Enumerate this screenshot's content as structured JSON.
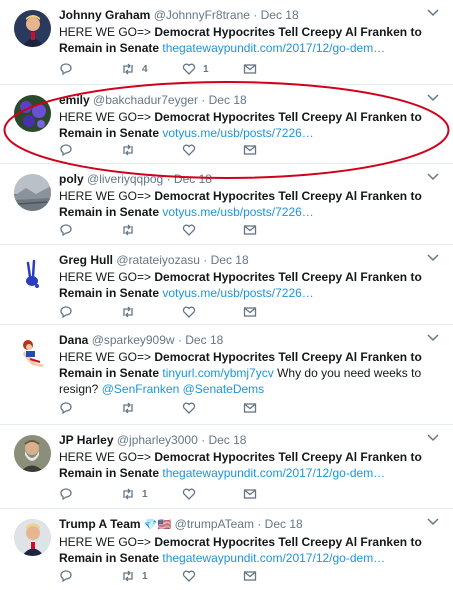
{
  "tweets": [
    {
      "name": "Johnny Graham",
      "handle": "@JohnnyFr8trane",
      "time": "Dec 18",
      "prefix": "HERE WE GO=> ",
      "bold": "Democrat Hypocrites Tell Creepy Al Franken to Remain in Senate",
      "link": "thegatewaypundit.com/2017/12/go-dem…",
      "extra": "",
      "mentions": "",
      "retweets": "4",
      "likes": "1",
      "avatar": "portrait-dark"
    },
    {
      "name": "emily",
      "handle": "@bakchadur7eyger",
      "time": "Dec 18",
      "prefix": "HERE WE GO=> ",
      "bold": "Democrat Hypocrites Tell Creepy Al Franken to Remain in Senate",
      "link": "votyus.me/usb/posts/7226…",
      "extra": "",
      "mentions": "",
      "retweets": "",
      "likes": "",
      "avatar": "purple-flowers"
    },
    {
      "name": "poly",
      "handle": "@liveriyqqpog",
      "time": "Dec 18",
      "prefix": "HERE WE GO=> ",
      "bold": "Democrat Hypocrites Tell Creepy Al Franken to Remain in Senate",
      "link": "votyus.me/usb/posts/7226…",
      "extra": "",
      "mentions": "",
      "retweets": "",
      "likes": "",
      "avatar": "grey-landscape"
    },
    {
      "name": "Greg Hull",
      "handle": "@ratateiyozasu",
      "time": "Dec 18",
      "prefix": "HERE WE GO=> ",
      "bold": "Democrat Hypocrites Tell Creepy Al Franken to Remain in Senate",
      "link": "votyus.me/usb/posts/7226…",
      "extra": "",
      "mentions": "",
      "retweets": "",
      "likes": "",
      "avatar": "blue-rabbit"
    },
    {
      "name": "Dana",
      "handle": "@sparkey909w",
      "time": "Dec 18",
      "prefix": "HERE WE GO=> ",
      "bold": "Democrat Hypocrites Tell Creepy Al Franken to Remain in Senate",
      "link": "tinyurl.com/ybmj7ycv",
      "extra": " Why do you need weeks to resign? ",
      "mention1": "@SenFranken",
      "mention2": "@SenateDems",
      "retweets": "",
      "likes": "",
      "avatar": "pinup"
    },
    {
      "name": "JP Harley",
      "handle": "@jpharley3000",
      "time": "Dec 18",
      "prefix": "HERE WE GO=> ",
      "bold": "Democrat Hypocrites Tell Creepy Al Franken to Remain in Senate",
      "link": "thegatewaypundit.com/2017/12/go-dem…",
      "extra": "",
      "mentions": "",
      "retweets": "1",
      "likes": "",
      "avatar": "bearded-man"
    },
    {
      "name": "Trump A Team",
      "flags": "💎🇺🇸",
      "handle": "@trumpATeam",
      "time": "Dec 18",
      "prefix": "HERE WE GO=> ",
      "bold": "Democrat Hypocrites Tell Creepy Al Franken to Remain in Senate",
      "link": "thegatewaypundit.com/2017/12/go-dem…",
      "extra": "",
      "mentions": "",
      "retweets": "1",
      "likes": "",
      "avatar": "portrait-light"
    }
  ],
  "sep": "·",
  "colors": {
    "link": "#1b95e0",
    "muted": "#657786",
    "text": "#14171a",
    "highlight": "#d0021b",
    "divider": "#e6ecf0"
  }
}
